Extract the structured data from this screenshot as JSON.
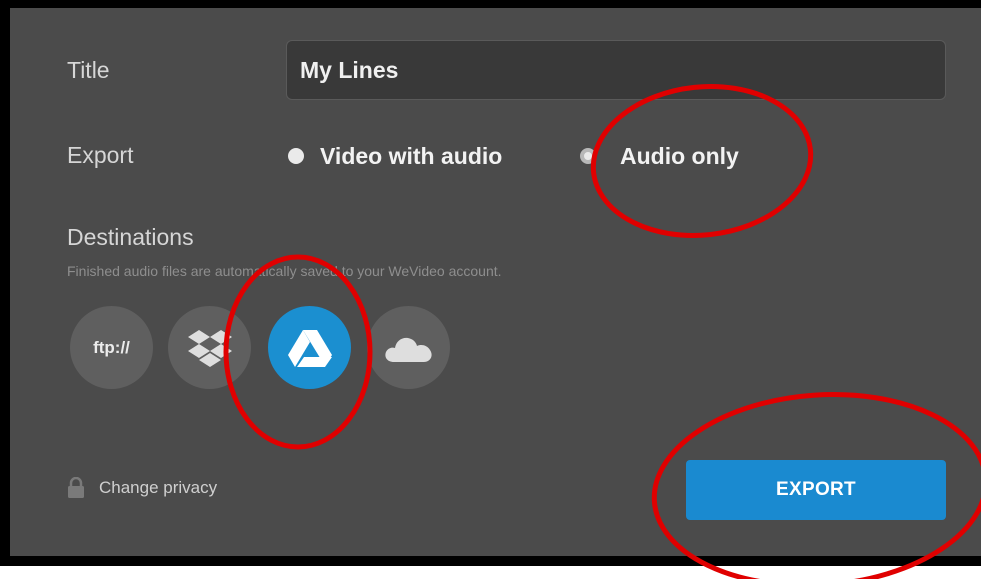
{
  "form": {
    "title_label": "Title",
    "title_value": "My Lines",
    "export_label": "Export",
    "export_options": [
      {
        "label": "Video with audio",
        "selected": false
      },
      {
        "label": "Audio only",
        "selected": true
      }
    ],
    "destinations_label": "Destinations",
    "destinations_hint": "Finished audio files are automatically saved to your WeVideo account.",
    "destinations": [
      {
        "icon": "ftp-icon",
        "label": "ftp://",
        "active": false
      },
      {
        "icon": "dropbox-icon",
        "active": false
      },
      {
        "icon": "google-drive-icon",
        "active": true
      },
      {
        "icon": "onedrive-icon",
        "active": false
      }
    ],
    "privacy_label": "Change privacy",
    "export_button": "EXPORT"
  },
  "colors": {
    "panel": "#4b4b4b",
    "accent": "#1a8ad0",
    "annotation": "#e00000"
  }
}
